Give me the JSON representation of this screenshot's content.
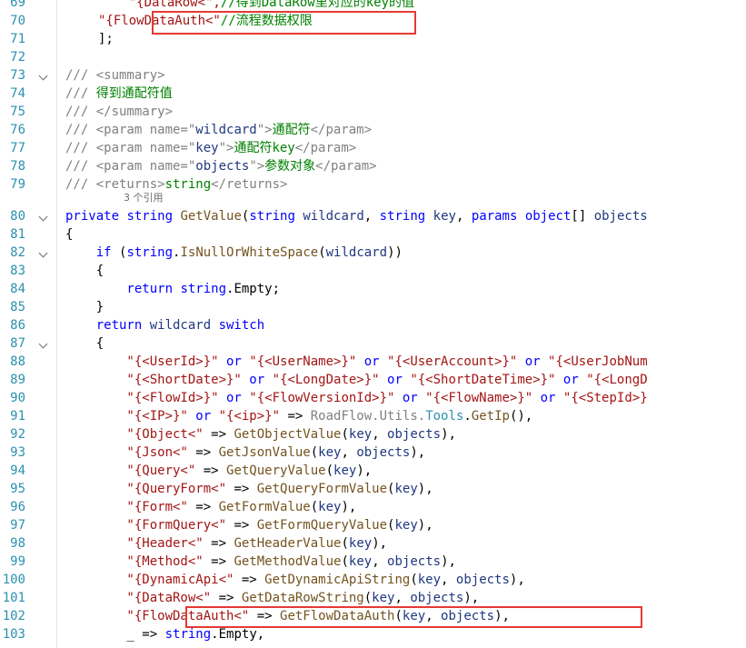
{
  "editor": {
    "references_label": "3 个引用",
    "lines": [
      {
        "num": "69",
        "tokens": [
          [
            "    \"{DataRow<\",",
            "st"
          ],
          [
            "//得到DataRow里对应的key的值",
            "cm"
          ]
        ]
      },
      {
        "num": "70",
        "tokens": [
          [
            "\"{FlowDataAuth<\"",
            "st"
          ],
          [
            "//流程数据权限",
            "cm"
          ]
        ]
      },
      {
        "num": "71",
        "tokens": [
          [
            "];",
            "tx"
          ]
        ]
      },
      {
        "num": "72",
        "tokens": []
      },
      {
        "num": "73",
        "tokens": [
          [
            "/// ",
            "xt"
          ],
          [
            "<summary>",
            "xt"
          ]
        ]
      },
      {
        "num": "74",
        "tokens": [
          [
            "/// ",
            "xt"
          ],
          [
            "得到通配符值",
            "cm"
          ]
        ]
      },
      {
        "num": "75",
        "tokens": [
          [
            "/// ",
            "xt"
          ],
          [
            "</summary>",
            "xt"
          ]
        ]
      },
      {
        "num": "76",
        "tokens": [
          [
            "/// ",
            "xt"
          ],
          [
            "<param name=\"",
            "xt"
          ],
          [
            "wildcard",
            "id"
          ],
          [
            "\">",
            "xt"
          ],
          [
            "通配符",
            "cm"
          ],
          [
            "</param>",
            "xt"
          ]
        ]
      },
      {
        "num": "77",
        "tokens": [
          [
            "/// ",
            "xt"
          ],
          [
            "<param name=\"",
            "xt"
          ],
          [
            "key",
            "id"
          ],
          [
            "\">",
            "xt"
          ],
          [
            "通配符key",
            "cm"
          ],
          [
            "</param>",
            "xt"
          ]
        ]
      },
      {
        "num": "78",
        "tokens": [
          [
            "/// ",
            "xt"
          ],
          [
            "<param name=\"",
            "xt"
          ],
          [
            "objects",
            "id"
          ],
          [
            "\">",
            "xt"
          ],
          [
            "参数对象",
            "cm"
          ],
          [
            "</param>",
            "xt"
          ]
        ]
      },
      {
        "num": "79",
        "tokens": [
          [
            "/// ",
            "xt"
          ],
          [
            "<returns>",
            "xt"
          ],
          [
            "string",
            "cm"
          ],
          [
            "</returns>",
            "xt"
          ]
        ]
      },
      {
        "num": "80",
        "tokens": [
          [
            "private ",
            "kw"
          ],
          [
            "string ",
            "kw"
          ],
          [
            "GetValue",
            "me"
          ],
          [
            "(",
            "tx"
          ],
          [
            "string ",
            "kw"
          ],
          [
            "wildcard",
            "id"
          ],
          [
            ", ",
            "tx"
          ],
          [
            "string ",
            "kw"
          ],
          [
            "key",
            "id"
          ],
          [
            ", ",
            "tx"
          ],
          [
            "params ",
            "kw"
          ],
          [
            "object",
            "kw"
          ],
          [
            "[] ",
            "tx"
          ],
          [
            "objects",
            "id"
          ]
        ]
      },
      {
        "num": "81",
        "tokens": [
          [
            "{",
            "tx"
          ]
        ]
      },
      {
        "num": "82",
        "tokens": [
          [
            "    if ",
            "kw"
          ],
          [
            "(",
            "tx"
          ],
          [
            "string",
            "kw"
          ],
          [
            ".",
            "tx"
          ],
          [
            "IsNullOrWhiteSpace",
            "me"
          ],
          [
            "(",
            "tx"
          ],
          [
            "wildcard",
            "id"
          ],
          [
            "))",
            "tx"
          ]
        ]
      },
      {
        "num": "83",
        "tokens": [
          [
            "    {",
            "tx"
          ]
        ]
      },
      {
        "num": "84",
        "tokens": [
          [
            "        return ",
            "kw"
          ],
          [
            "string",
            "kw"
          ],
          [
            ".Empty;",
            "tx"
          ]
        ]
      },
      {
        "num": "85",
        "tokens": [
          [
            "    }",
            "tx"
          ]
        ]
      },
      {
        "num": "86",
        "tokens": [
          [
            "    return ",
            "kw"
          ],
          [
            "wildcard ",
            "id"
          ],
          [
            "switch",
            "kw"
          ]
        ]
      },
      {
        "num": "87",
        "tokens": [
          [
            "    {",
            "tx"
          ]
        ]
      },
      {
        "num": "88",
        "tokens": [
          [
            "        \"{<UserId>}\"",
            "st"
          ],
          [
            " or ",
            "kw"
          ],
          [
            "\"{<UserName>}\"",
            "st"
          ],
          [
            " or ",
            "kw"
          ],
          [
            "\"{<UserAccount>}\"",
            "st"
          ],
          [
            " or ",
            "kw"
          ],
          [
            "\"{<UserJobNum",
            "st"
          ]
        ]
      },
      {
        "num": "89",
        "tokens": [
          [
            "        \"{<ShortDate>}\"",
            "st"
          ],
          [
            " or ",
            "kw"
          ],
          [
            "\"{<LongDate>}\"",
            "st"
          ],
          [
            " or ",
            "kw"
          ],
          [
            "\"{<ShortDateTime>}\"",
            "st"
          ],
          [
            " or ",
            "kw"
          ],
          [
            "\"{<LongD",
            "st"
          ]
        ]
      },
      {
        "num": "90",
        "tokens": [
          [
            "        \"{<FlowId>}\"",
            "st"
          ],
          [
            " or ",
            "kw"
          ],
          [
            "\"{<FlowVersionId>}\"",
            "st"
          ],
          [
            " or ",
            "kw"
          ],
          [
            "\"{<FlowName>}\"",
            "st"
          ],
          [
            " or ",
            "kw"
          ],
          [
            "\"{<StepId>}",
            "st"
          ]
        ]
      },
      {
        "num": "91",
        "tokens": [
          [
            "        \"{<IP>}\"",
            "st"
          ],
          [
            " or ",
            "kw"
          ],
          [
            "\"{<ip>}\"",
            "st"
          ],
          [
            " => ",
            "tx"
          ],
          [
            "RoadFlow",
            "xn"
          ],
          [
            ".",
            "xn"
          ],
          [
            "Utils",
            "xn"
          ],
          [
            ".",
            "xn"
          ],
          [
            "Tools",
            "ty"
          ],
          [
            ".",
            "tx"
          ],
          [
            "GetIp",
            "me"
          ],
          [
            "(),",
            "tx"
          ]
        ]
      },
      {
        "num": "92",
        "tokens": [
          [
            "        \"{Object<\"",
            "st"
          ],
          [
            " => ",
            "tx"
          ],
          [
            "GetObjectValue",
            "me"
          ],
          [
            "(",
            "tx"
          ],
          [
            "key",
            "id"
          ],
          [
            ", ",
            "tx"
          ],
          [
            "objects",
            "id"
          ],
          [
            "),",
            "tx"
          ]
        ]
      },
      {
        "num": "93",
        "tokens": [
          [
            "        \"{Json<\"",
            "st"
          ],
          [
            " => ",
            "tx"
          ],
          [
            "GetJsonValue",
            "me"
          ],
          [
            "(",
            "tx"
          ],
          [
            "key",
            "id"
          ],
          [
            ", ",
            "tx"
          ],
          [
            "objects",
            "id"
          ],
          [
            "),",
            "tx"
          ]
        ]
      },
      {
        "num": "94",
        "tokens": [
          [
            "        \"{Query<\"",
            "st"
          ],
          [
            " => ",
            "tx"
          ],
          [
            "GetQueryValue",
            "me"
          ],
          [
            "(",
            "tx"
          ],
          [
            "key",
            "id"
          ],
          [
            "),",
            "tx"
          ]
        ]
      },
      {
        "num": "95",
        "tokens": [
          [
            "        \"{QueryForm<\"",
            "st"
          ],
          [
            " => ",
            "tx"
          ],
          [
            "GetQueryFormValue",
            "me"
          ],
          [
            "(",
            "tx"
          ],
          [
            "key",
            "id"
          ],
          [
            "),",
            "tx"
          ]
        ]
      },
      {
        "num": "96",
        "tokens": [
          [
            "        \"{Form<\"",
            "st"
          ],
          [
            " => ",
            "tx"
          ],
          [
            "GetFormValue",
            "me"
          ],
          [
            "(",
            "tx"
          ],
          [
            "key",
            "id"
          ],
          [
            "),",
            "tx"
          ]
        ]
      },
      {
        "num": "97",
        "tokens": [
          [
            "        \"{FormQuery<\"",
            "st"
          ],
          [
            " => ",
            "tx"
          ],
          [
            "GetFormQueryValue",
            "me"
          ],
          [
            "(",
            "tx"
          ],
          [
            "key",
            "id"
          ],
          [
            "),",
            "tx"
          ]
        ]
      },
      {
        "num": "98",
        "tokens": [
          [
            "        \"{Header<\"",
            "st"
          ],
          [
            " => ",
            "tx"
          ],
          [
            "GetHeaderValue",
            "me"
          ],
          [
            "(",
            "tx"
          ],
          [
            "key",
            "id"
          ],
          [
            "),",
            "tx"
          ]
        ]
      },
      {
        "num": "99",
        "tokens": [
          [
            "        \"{Method<\"",
            "st"
          ],
          [
            " => ",
            "tx"
          ],
          [
            "GetMethodValue",
            "me"
          ],
          [
            "(",
            "tx"
          ],
          [
            "key",
            "id"
          ],
          [
            ", ",
            "tx"
          ],
          [
            "objects",
            "id"
          ],
          [
            "),",
            "tx"
          ]
        ]
      },
      {
        "num": "100",
        "tokens": [
          [
            "        \"{DynamicApi<\"",
            "st"
          ],
          [
            " => ",
            "tx"
          ],
          [
            "GetDynamicApiString",
            "me"
          ],
          [
            "(",
            "tx"
          ],
          [
            "key",
            "id"
          ],
          [
            ", ",
            "tx"
          ],
          [
            "objects",
            "id"
          ],
          [
            "),",
            "tx"
          ]
        ]
      },
      {
        "num": "101",
        "tokens": [
          [
            "        \"{DataRow<\"",
            "st"
          ],
          [
            " => ",
            "tx"
          ],
          [
            "GetDataRowString",
            "me"
          ],
          [
            "(",
            "tx"
          ],
          [
            "key",
            "id"
          ],
          [
            ", ",
            "tx"
          ],
          [
            "objects",
            "id"
          ],
          [
            "),",
            "tx"
          ]
        ]
      },
      {
        "num": "102",
        "tokens": [
          [
            "        \"{FlowDataAuth<\"",
            "st"
          ],
          [
            " => ",
            "tx"
          ],
          [
            "GetFlowDataAuth",
            "me"
          ],
          [
            "(",
            "tx"
          ],
          [
            "key",
            "id"
          ],
          [
            ", ",
            "tx"
          ],
          [
            "objects",
            "id"
          ],
          [
            "),",
            "tx"
          ]
        ]
      },
      {
        "num": "103",
        "tokens": [
          [
            "        _ ",
            "tx"
          ],
          [
            "=> ",
            "tx"
          ],
          [
            "string",
            "kw"
          ],
          [
            ".Empty,",
            "tx"
          ]
        ]
      }
    ]
  }
}
